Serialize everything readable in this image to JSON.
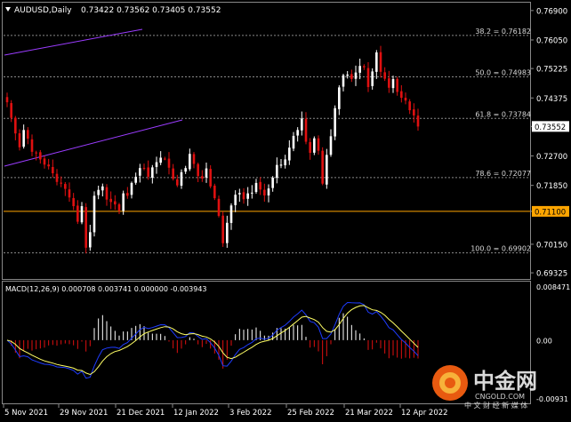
{
  "header": {
    "symbol": "AUDUSD,Daily",
    "quote": "0.73422 0.73562 0.73405 0.73552"
  },
  "chart_data": {
    "type": "candlestick",
    "price_axis": {
      "ticks": [
        "0.76900",
        "0.76050",
        "0.75225",
        "0.74375",
        "0.73552",
        "0.72700",
        "0.71850",
        "0.71100",
        "0.70150",
        "0.69325"
      ],
      "tick_values": [
        0.769,
        0.7605,
        0.75225,
        0.74375,
        0.73552,
        0.727,
        0.7185,
        0.711,
        0.7015,
        0.69325
      ],
      "range": [
        0.6925,
        0.7705
      ],
      "current_price_label": "0.73552",
      "highlight_label": "0.71100"
    },
    "date_axis": [
      "5 Nov 2021",
      "29 Nov 2021",
      "21 Dec 2021",
      "12 Jan 2022",
      "3 Feb 2022",
      "25 Feb 2022",
      "21 Mar 2022",
      "12 Apr 2022"
    ],
    "fib_levels": [
      {
        "label": "38.2 = 0.76182",
        "value": 0.76182
      },
      {
        "label": "50.0 = 0.74983",
        "value": 0.74983
      },
      {
        "label": "61.8 = 0.73784",
        "value": 0.73784
      },
      {
        "label": "78.6 = 0.72077",
        "value": 0.72077
      },
      {
        "label": "100.0 = 0.69902",
        "value": 0.69902
      }
    ],
    "horizontal_line": {
      "value": 0.711,
      "color": "#ffa500"
    },
    "closes": [
      0.7425,
      0.738,
      0.7335,
      0.7295,
      0.7345,
      0.732,
      0.7282,
      0.7278,
      0.726,
      0.7245,
      0.724,
      0.722,
      0.7195,
      0.719,
      0.7175,
      0.715,
      0.7125,
      0.708,
      0.7125,
      0.7005,
      0.705,
      0.7155,
      0.7172,
      0.7182,
      0.7144,
      0.7137,
      0.713,
      0.7112,
      0.7162,
      0.7155,
      0.7192,
      0.721,
      0.7235,
      0.7235,
      0.721,
      0.7237,
      0.7252,
      0.7265,
      0.7262,
      0.7236,
      0.7204,
      0.7185,
      0.7223,
      0.7235,
      0.7276,
      0.7247,
      0.7212,
      0.7205,
      0.7234,
      0.7182,
      0.7148,
      0.7097,
      0.7018,
      0.7077,
      0.7127,
      0.7158,
      0.7163,
      0.7145,
      0.7162,
      0.7164,
      0.7192,
      0.7173,
      0.7156,
      0.7176,
      0.7207,
      0.7244,
      0.7245,
      0.726,
      0.7294,
      0.7328,
      0.7345,
      0.7378,
      0.7311,
      0.7279,
      0.7321,
      0.7285,
      0.719,
      0.7273,
      0.7327,
      0.7408,
      0.7468,
      0.7503,
      0.7505,
      0.7492,
      0.7511,
      0.753,
      0.7526,
      0.7469,
      0.7514,
      0.7569,
      0.7513,
      0.7493,
      0.7467,
      0.7492,
      0.7455,
      0.7438,
      0.743,
      0.7402,
      0.7387,
      0.7355
    ],
    "macd": {
      "label": "MACD(12,26,9) 0.000708 0.003741 0.000000 -0.003943",
      "axis_ticks": [
        "0.008471",
        "0.00",
        "-0.00931"
      ],
      "range": [
        -0.00931,
        0.008471
      ]
    }
  },
  "watermark": {
    "brand": "中金网",
    "domain": "CNGOLD.COM",
    "slogan": "中 文 财 经 新 媒 体"
  },
  "colors": {
    "background": "#000000",
    "bull": "#ffffff",
    "bear": "#e01010",
    "grid": "#666666",
    "macd_signal": "#ffff66",
    "macd_line": "#1e3cff",
    "trend_line": "#9b3cff",
    "highlight": "#ffa500"
  }
}
